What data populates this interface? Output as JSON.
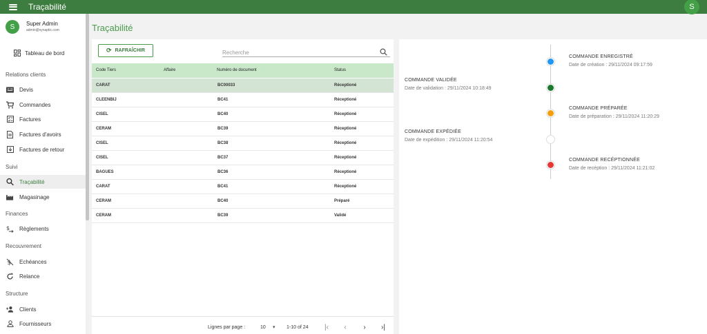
{
  "app": {
    "title": "Traçabilité",
    "top_avatar": "S"
  },
  "user": {
    "avatar": "S",
    "name": "Super Admin",
    "email": "admin@synaptic.com"
  },
  "sidebar": {
    "dashboard": "Tableau de bord",
    "sections": {
      "relations": "Relations clients",
      "suivi": "Suivi",
      "finances": "Finances",
      "recouvrement": "Recouvrement",
      "structure": "Structure"
    },
    "items": {
      "devis": "Devis",
      "commandes": "Commandes",
      "factures": "Factures",
      "factures_avoirs": "Factures d'avoirs",
      "factures_retour": "Factures de retour",
      "tracabilite": "Traçabilité",
      "magasinage": "Magasinage",
      "reglements": "Règlements",
      "echeances": "Echéances",
      "relance": "Relance",
      "clients": "Clients",
      "fournisseurs": "Fournisseurs"
    }
  },
  "main": {
    "title": "Traçabilité",
    "refresh_label": "RAFRAÎCHIR",
    "search_placeholder": "Recherche",
    "columns": {
      "code": "Code Tiers",
      "affaire": "Affaire",
      "numero": "Numéro de document",
      "status": "Status"
    },
    "rows": [
      {
        "code": "CARAT",
        "affaire": "",
        "numero": "BC00033",
        "status": "Réceptioné"
      },
      {
        "code": "CLEENBIJ",
        "affaire": "",
        "numero": "BC41",
        "status": "Réceptioné"
      },
      {
        "code": "CISEL",
        "affaire": "",
        "numero": "BC40",
        "status": "Réceptioné"
      },
      {
        "code": "CERAM",
        "affaire": "",
        "numero": "BC39",
        "status": "Réceptioné"
      },
      {
        "code": "CISEL",
        "affaire": "",
        "numero": "BC38",
        "status": "Réceptioné"
      },
      {
        "code": "CISEL",
        "affaire": "",
        "numero": "BC37",
        "status": "Réceptioné"
      },
      {
        "code": "BAGUES",
        "affaire": "",
        "numero": "BC36",
        "status": "Réceptioné"
      },
      {
        "code": "CARAT",
        "affaire": "",
        "numero": "BC41",
        "status": "Réceptioné"
      },
      {
        "code": "CERAM",
        "affaire": "",
        "numero": "BC40",
        "status": "Préparé"
      },
      {
        "code": "CERAM",
        "affaire": "",
        "numero": "BC39",
        "status": "Validé"
      }
    ],
    "pager": {
      "rows_label": "Lignes par page :",
      "rows_value": "10",
      "range": "1-10 of 24"
    }
  },
  "timeline": [
    {
      "title": "COMMANDE ENREGISTRÉ",
      "date": "Date de création : 29/11/2024 09:17:59",
      "color": "#2196f3",
      "side": "right"
    },
    {
      "title": "COMMANDE VALIDÉE",
      "date": "Date de validation : 29/11/2024 10:18:49",
      "color": "#1b7a2b",
      "side": "left"
    },
    {
      "title": "COMMANDE PRÉPARÉE",
      "date": "Date de préparation : 29/11/2024 11:20:29",
      "color": "#f59e0b",
      "side": "right"
    },
    {
      "title": "COMMANDE EXPÉDIÉE",
      "date": "Date de expédition : 29/11/2024 11:20:54",
      "color": "#ffffff",
      "side": "left"
    },
    {
      "title": "COMMANDE RECÉPTIONNÉE",
      "date": "Date de recéption : 29/11/2024 11:21:02",
      "color": "#e53935",
      "side": "right"
    }
  ]
}
